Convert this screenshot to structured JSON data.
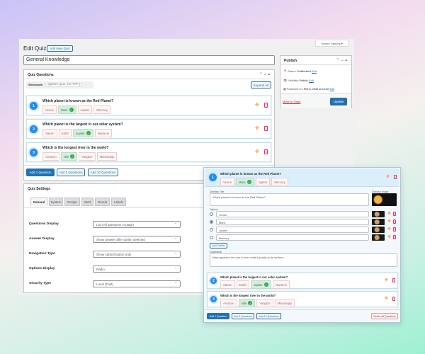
{
  "page": {
    "title": "Edit Quiz",
    "add_new": "Add New Quiz",
    "screen_options": "Screen Options ▾",
    "quiz_title": "General Knowledge"
  },
  "questions_box": {
    "title": "Quiz Questions",
    "shortcode_label": "Shortcode:",
    "shortcode": "[wpdevs_quiz id=\"475\"]",
    "expand_all": "Expand All",
    "questions": [
      {
        "num": "1",
        "text": "Which planet is known as the Red Planet?",
        "options": [
          "Venus",
          "Mars",
          "Jupiter",
          "Mercury"
        ],
        "correct": 1
      },
      {
        "num": "2",
        "text": "Which planet is the largest in our solar system?",
        "options": [
          "Saturn",
          "Earth",
          "Jupiter",
          "Neptune"
        ],
        "correct": 2
      },
      {
        "num": "3",
        "text": "Which is the longest river in the world?",
        "options": [
          "Amazon",
          "Nile",
          "Yangtze",
          "Mississippi"
        ],
        "correct": 1
      }
    ],
    "add1": "Add 1 Question",
    "add5": "Add 5 Questions",
    "add10": "Add 10 Questions"
  },
  "publish": {
    "title": "Publish",
    "status_label": "Status:",
    "status": "Published",
    "visibility_label": "Visibility:",
    "visibility": "Public",
    "published_label": "Published on:",
    "published": "Feb 8, 2026 at 12:20",
    "edit": "Edit",
    "trash": "Move to Trash",
    "update": "Update"
  },
  "settings": {
    "title": "Quiz Settings",
    "tabs": [
      "General",
      "System",
      "Design",
      "Start",
      "Result",
      "Labels"
    ],
    "rows": [
      {
        "label": "Questions Display",
        "value": "List (All questions in page)"
      },
      {
        "label": "Answer Display",
        "value": "Show answer after option selected"
      },
      {
        "label": "Navigation Type",
        "value": "Show submit button only"
      },
      {
        "label": "Options Display",
        "value": "Radio"
      },
      {
        "label": "Security Type",
        "value": "Local (Fast)"
      }
    ]
  },
  "overlay": {
    "question_title_label": "Question Title",
    "question_title": "Which planet is known as the Red Planet?",
    "question_image_label": "Question Image",
    "options_label": "Options",
    "options": [
      "Venus",
      "Mars",
      "Jupiter",
      "Mercury"
    ],
    "selected": 1,
    "add_option": "Add Option",
    "explanation_label": "Explanation",
    "explanation": "Mars appears red due to iron oxide's (rust) on its surface.",
    "delete_all": "Delete All Questions"
  }
}
